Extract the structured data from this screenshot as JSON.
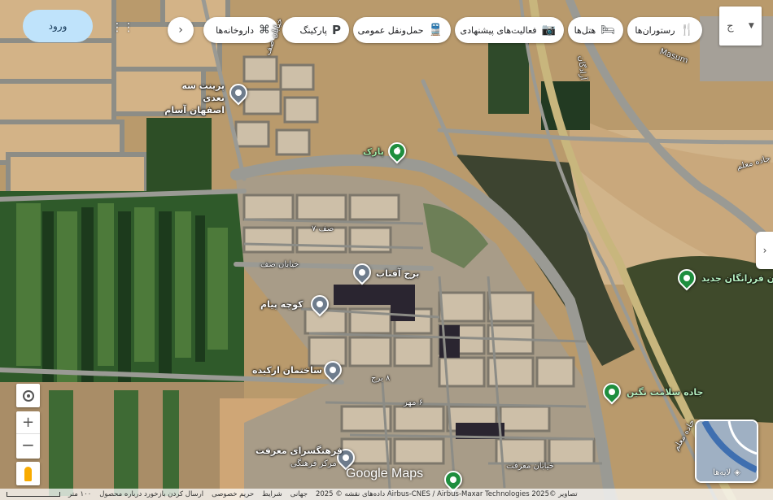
{
  "header": {
    "signin_label": "ورود",
    "categories": [
      {
        "id": "restaurants",
        "label": "رستوران‌ها",
        "icon": "🍴"
      },
      {
        "id": "hotels",
        "label": "هتل‌ها",
        "icon": "🛏"
      },
      {
        "id": "things",
        "label": "فعالیت‌های پیشنهادی",
        "icon": "📷"
      },
      {
        "id": "transit",
        "label": "حمل‌ونقل عمومی",
        "icon": "🚆"
      },
      {
        "id": "parking",
        "label": "پارکینگ",
        "icon": "P"
      },
      {
        "id": "pharmacies",
        "label": "داروخانه‌ها",
        "icon": "⌘"
      }
    ],
    "more_label": "ج"
  },
  "places": {
    "bookstore": "پرینت سه بعدی\nاصفهان آسام",
    "park": "پارک",
    "tower": "برج آفتاب",
    "alley": "کوچه پیام",
    "building": "ساختمان ارکیده",
    "culture": "فرهنگسرای معرفت",
    "culture_sub": "مرکز فرهنگی",
    "farzanegan": "هنرستان فرزانگان جدید",
    "health_road": "جاده سلامت نگین"
  },
  "roads": {
    "saf": "خیابان صف",
    "saf7": "صف ۷",
    "saf_top": "خیابان صف",
    "borj8": "۸ برج",
    "mehr6": "۶ مهر",
    "marefat": "خیابان معرفت",
    "azadegan": "آزادگان",
    "moalem": "جاده معلم",
    "masum": "Masum",
    "moalem2": "جاده معلم"
  },
  "map": {
    "brand": "Google Maps",
    "layers_label": "لایه‌ها"
  },
  "footer": {
    "imagery": "تصاویر ©2025 Airbus-CNES / Airbus-Maxar Technologies داده‌های نقشه © 2025",
    "country": "جهانی",
    "terms": "شرایط",
    "privacy": "حریم خصوصی",
    "feedback": "ارسال کردن بازخورد درباره محصول",
    "scale": "۱۰۰ متر"
  },
  "colors": {
    "pin_gray": "#6e7c8c",
    "pin_green": "#1e8e3e",
    "signin_bg": "#bfe3fb",
    "farmland": "#2f5a2a",
    "desert": "#c8a97a"
  }
}
